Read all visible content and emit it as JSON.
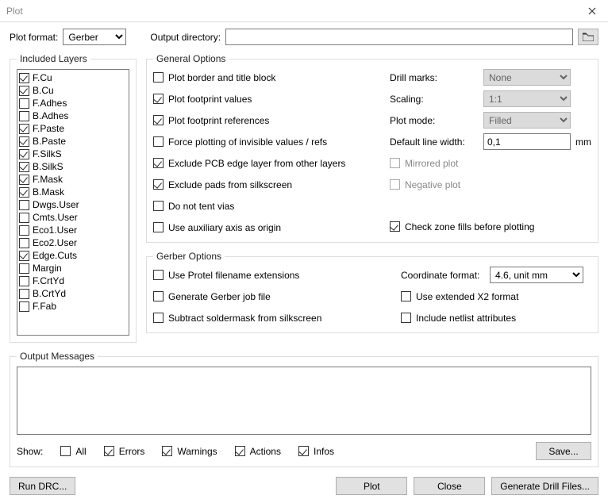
{
  "window": {
    "title": "Plot"
  },
  "top": {
    "plot_format_label": "Plot format:",
    "plot_format_value": "Gerber",
    "output_dir_label": "Output directory:",
    "output_dir_value": ""
  },
  "layers": {
    "legend": "Included Layers",
    "items": [
      {
        "label": "F.Cu",
        "checked": true
      },
      {
        "label": "B.Cu",
        "checked": true
      },
      {
        "label": "F.Adhes",
        "checked": false
      },
      {
        "label": "B.Adhes",
        "checked": false
      },
      {
        "label": "F.Paste",
        "checked": true
      },
      {
        "label": "B.Paste",
        "checked": true
      },
      {
        "label": "F.SilkS",
        "checked": true
      },
      {
        "label": "B.SilkS",
        "checked": true
      },
      {
        "label": "F.Mask",
        "checked": true
      },
      {
        "label": "B.Mask",
        "checked": true
      },
      {
        "label": "Dwgs.User",
        "checked": false
      },
      {
        "label": "Cmts.User",
        "checked": false
      },
      {
        "label": "Eco1.User",
        "checked": false
      },
      {
        "label": "Eco2.User",
        "checked": false
      },
      {
        "label": "Edge.Cuts",
        "checked": true
      },
      {
        "label": "Margin",
        "checked": false
      },
      {
        "label": "F.CrtYd",
        "checked": false
      },
      {
        "label": "B.CrtYd",
        "checked": false
      },
      {
        "label": "F.Fab",
        "checked": false
      }
    ]
  },
  "general": {
    "legend": "General Options",
    "left": [
      {
        "label": "Plot border and title block",
        "checked": false
      },
      {
        "label": "Plot footprint values",
        "checked": true
      },
      {
        "label": "Plot footprint references",
        "checked": true
      },
      {
        "label": "Force plotting of invisible values / refs",
        "checked": false
      },
      {
        "label": "Exclude PCB edge layer from other layers",
        "checked": true
      },
      {
        "label": "Exclude pads from silkscreen",
        "checked": true
      },
      {
        "label": "Do not tent vias",
        "checked": false
      },
      {
        "label": "Use auxiliary axis as origin",
        "checked": false
      }
    ],
    "drill_marks_label": "Drill marks:",
    "drill_marks_value": "None",
    "scaling_label": "Scaling:",
    "scaling_value": "1:1",
    "plot_mode_label": "Plot mode:",
    "plot_mode_value": "Filled",
    "line_width_label": "Default line width:",
    "line_width_value": "0,1",
    "line_width_unit": "mm",
    "mirrored_label": "Mirrored plot",
    "negative_label": "Negative plot",
    "check_zones_label": "Check zone fills before plotting"
  },
  "gerber": {
    "legend": "Gerber Options",
    "left": [
      {
        "label": "Use Protel filename extensions",
        "checked": false
      },
      {
        "label": "Generate Gerber job file",
        "checked": false
      },
      {
        "label": "Subtract soldermask from silkscreen",
        "checked": false
      }
    ],
    "coord_label": "Coordinate format:",
    "coord_value": "4.6, unit mm",
    "ext_x2_label": "Use extended X2 format",
    "netlist_label": "Include netlist attributes"
  },
  "messages": {
    "legend": "Output Messages",
    "text": ""
  },
  "filters": {
    "show_label": "Show:",
    "all": "All",
    "errors": "Errors",
    "warnings": "Warnings",
    "actions": "Actions",
    "infos": "Infos",
    "save": "Save..."
  },
  "buttons": {
    "run_drc": "Run DRC...",
    "plot": "Plot",
    "close": "Close",
    "drill": "Generate Drill Files..."
  }
}
